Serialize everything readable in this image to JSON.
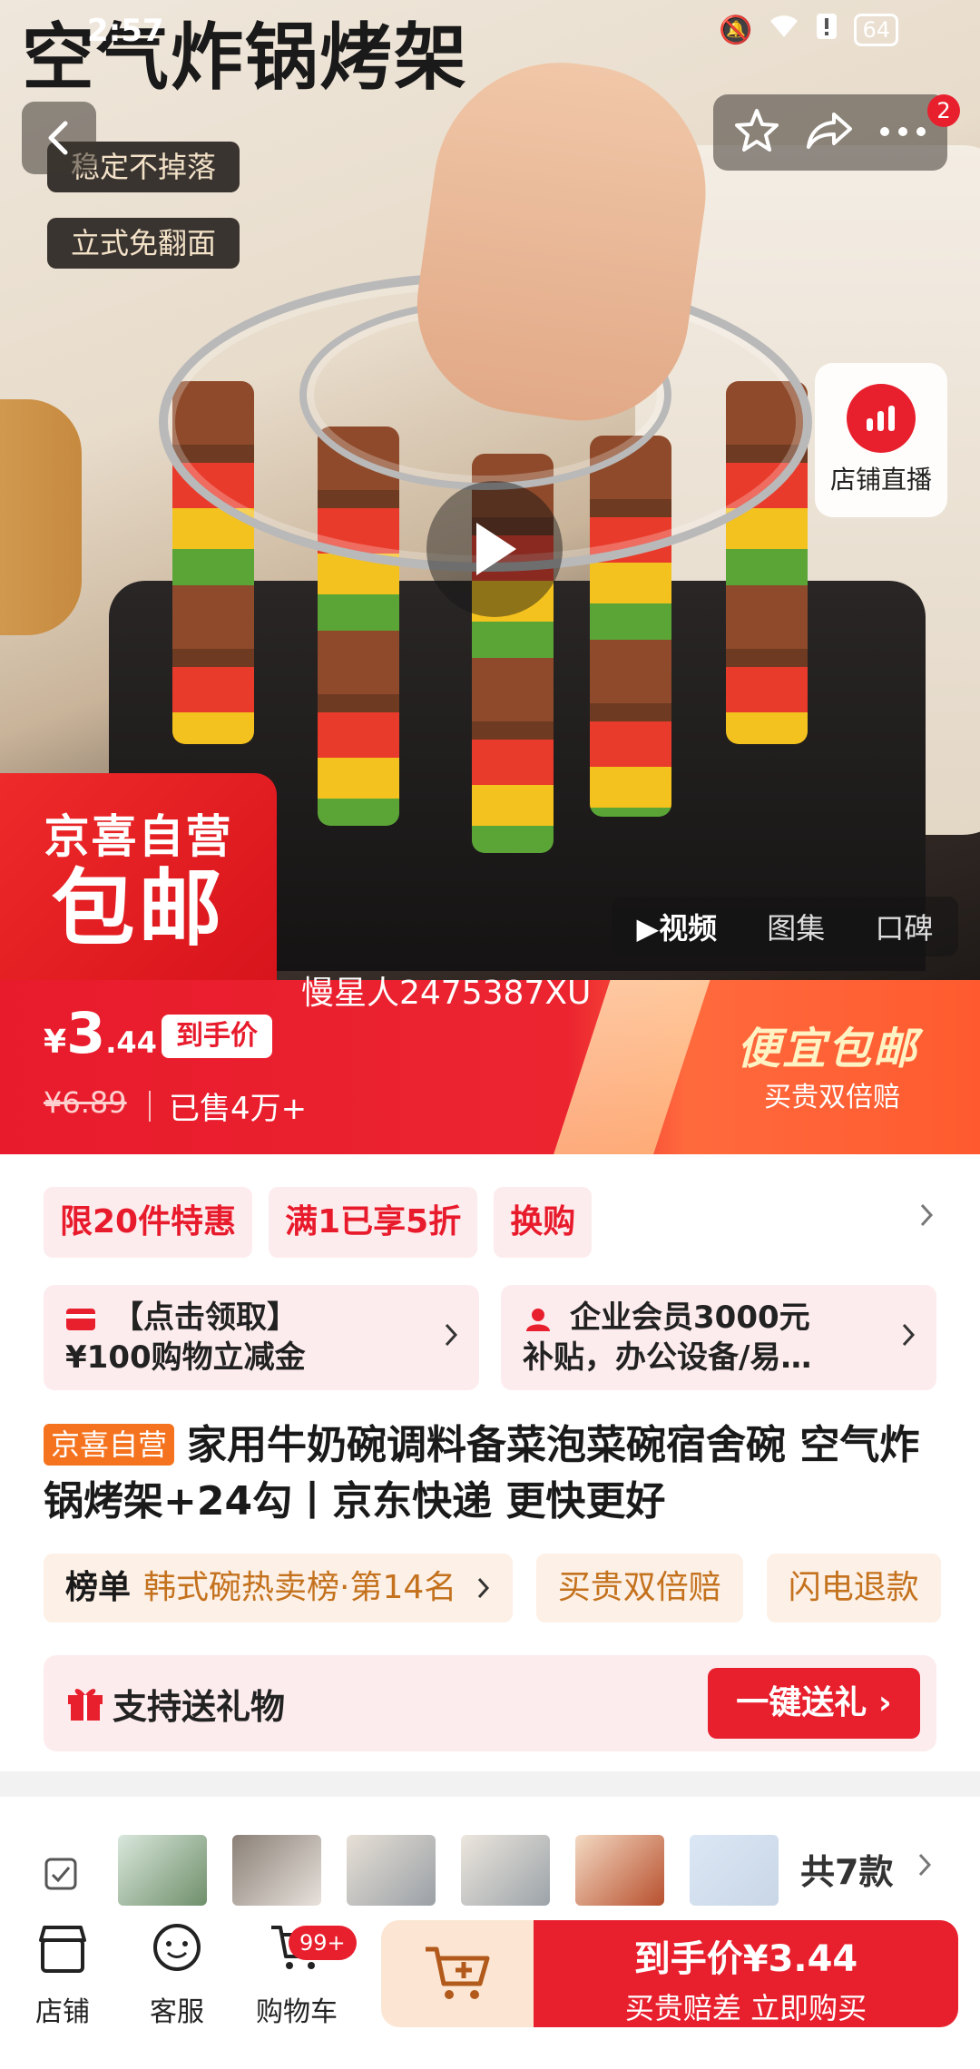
{
  "status_bar": {
    "time": "2:57",
    "battery": "64"
  },
  "hero": {
    "title": "空气炸锅烤架",
    "tags": [
      "稳定不掉落",
      "立式免翻面"
    ],
    "notification_count": "2",
    "live_label": "店铺直播",
    "ribbon_line1": "京喜自营",
    "ribbon_line2": "包邮",
    "media_tabs": [
      "视频",
      "图集",
      "口碑"
    ],
    "watermark": "慢星人2475387XU"
  },
  "price": {
    "currency": "¥",
    "integer": "3",
    "decimal": ".44",
    "badge": "到手价",
    "original": "¥6.89",
    "sold": "已售4万+",
    "promo_title": "便宜包邮",
    "promo_sub": "买贵双倍赔"
  },
  "coupons": [
    "限20件特惠",
    "满1已享5折",
    "换购"
  ],
  "benefits": [
    {
      "line1": "【点击领取】",
      "line2": "¥100购物立减金"
    },
    {
      "line1": "企业会员3000元",
      "line2": "补贴，办公设备/易…"
    }
  ],
  "product": {
    "shop_tag": "京喜自营",
    "title": "家用牛奶碗调料备菜泡菜碗宿舍碗 空气炸锅烤架+24勾丨京东快递 更快更好"
  },
  "ranks": [
    {
      "head": "榜单",
      "text": "韩式碗热卖榜·第14名"
    },
    {
      "head": "",
      "text": "买贵双倍赔"
    },
    {
      "head": "",
      "text": "闪电退款"
    }
  ],
  "gift": {
    "label": "支持送礼物",
    "button": "一键送礼"
  },
  "variants": {
    "count": "共7款"
  },
  "bottom_bar": {
    "shop": "店铺",
    "service": "客服",
    "cart": "购物车",
    "cart_badge": "99+",
    "buy_line1": "到手价¥3.44",
    "buy_line2": "买贵赔差 立即购买"
  },
  "colors": {
    "brand_red": "#e8202e",
    "orange": "#f5731e",
    "pink_bg": "#fdecee"
  }
}
